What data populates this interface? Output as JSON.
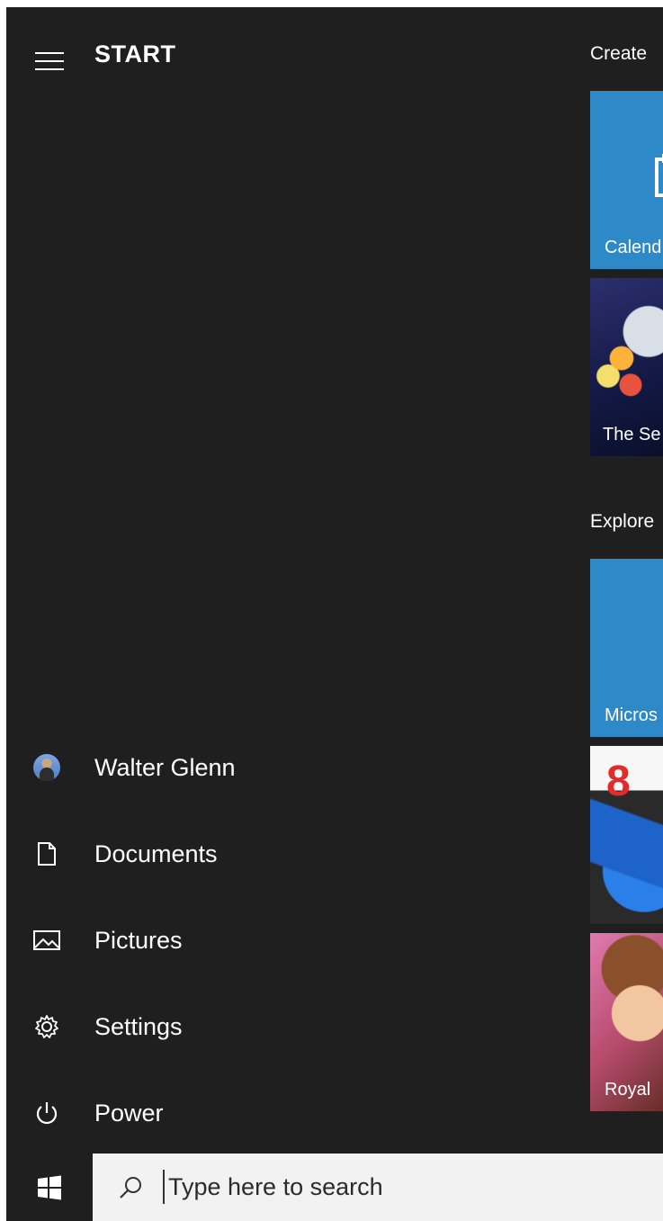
{
  "start_menu": {
    "title": "START",
    "nav": [
      {
        "name": "user",
        "label": "Walter Glenn",
        "icon": "user-avatar-icon"
      },
      {
        "name": "documents",
        "label": "Documents",
        "icon": "document-icon"
      },
      {
        "name": "pictures",
        "label": "Pictures",
        "icon": "picture-icon"
      },
      {
        "name": "settings",
        "label": "Settings",
        "icon": "gear-icon"
      },
      {
        "name": "power",
        "label": "Power",
        "icon": "power-icon"
      }
    ],
    "groups": [
      {
        "label": "Create",
        "tiles": [
          {
            "label": "Calend"
          },
          {
            "label": "The Se"
          }
        ]
      },
      {
        "label": "Explore",
        "tiles": [
          {
            "label": "Micros"
          },
          {
            "label": ""
          },
          {
            "label": "Royal"
          }
        ]
      }
    ]
  },
  "taskbar": {
    "search_placeholder": "Type here to search"
  },
  "colors": {
    "menu_bg": "#1f1f1f",
    "tile_blue": "#2d89c8",
    "search_bg": "#f2f2f2"
  }
}
